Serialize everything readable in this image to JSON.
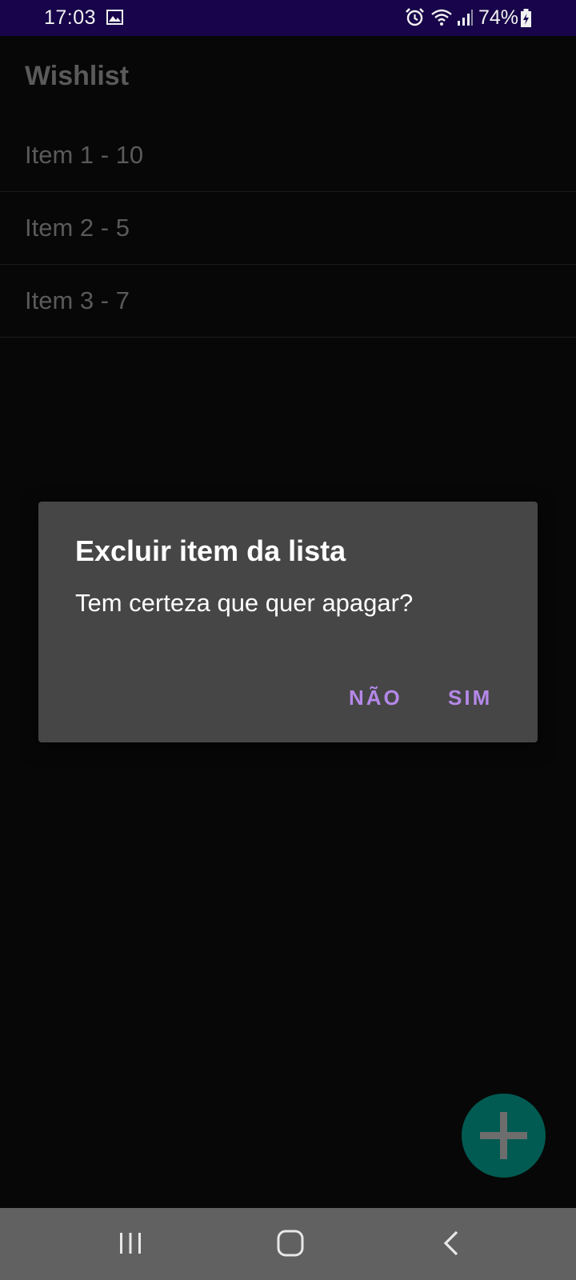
{
  "status_bar": {
    "time": "17:03",
    "battery": "74%",
    "icons": [
      "gallery-icon",
      "alarm-icon",
      "wifi-icon",
      "signal-icon",
      "battery-charging-icon"
    ]
  },
  "app": {
    "title": "Wishlist"
  },
  "list": {
    "items": [
      {
        "label": "Item 1 - 10"
      },
      {
        "label": "Item 2 - 5"
      },
      {
        "label": "Item 3 - 7"
      }
    ]
  },
  "dialog": {
    "title": "Excluir item da lista",
    "message": "Tem certeza que quer apagar?",
    "negative_label": "NÃO",
    "positive_label": "SIM"
  },
  "fab": {
    "icon": "plus-icon"
  },
  "nav_bar": {
    "icons": [
      "recents-icon",
      "home-icon",
      "back-icon"
    ]
  },
  "colors": {
    "status_bar": "#17044a",
    "background": "#070707",
    "dialog_background": "#464646",
    "dialog_button": "#b488e8",
    "fab": "#015b52",
    "nav_bar": "#616161"
  }
}
